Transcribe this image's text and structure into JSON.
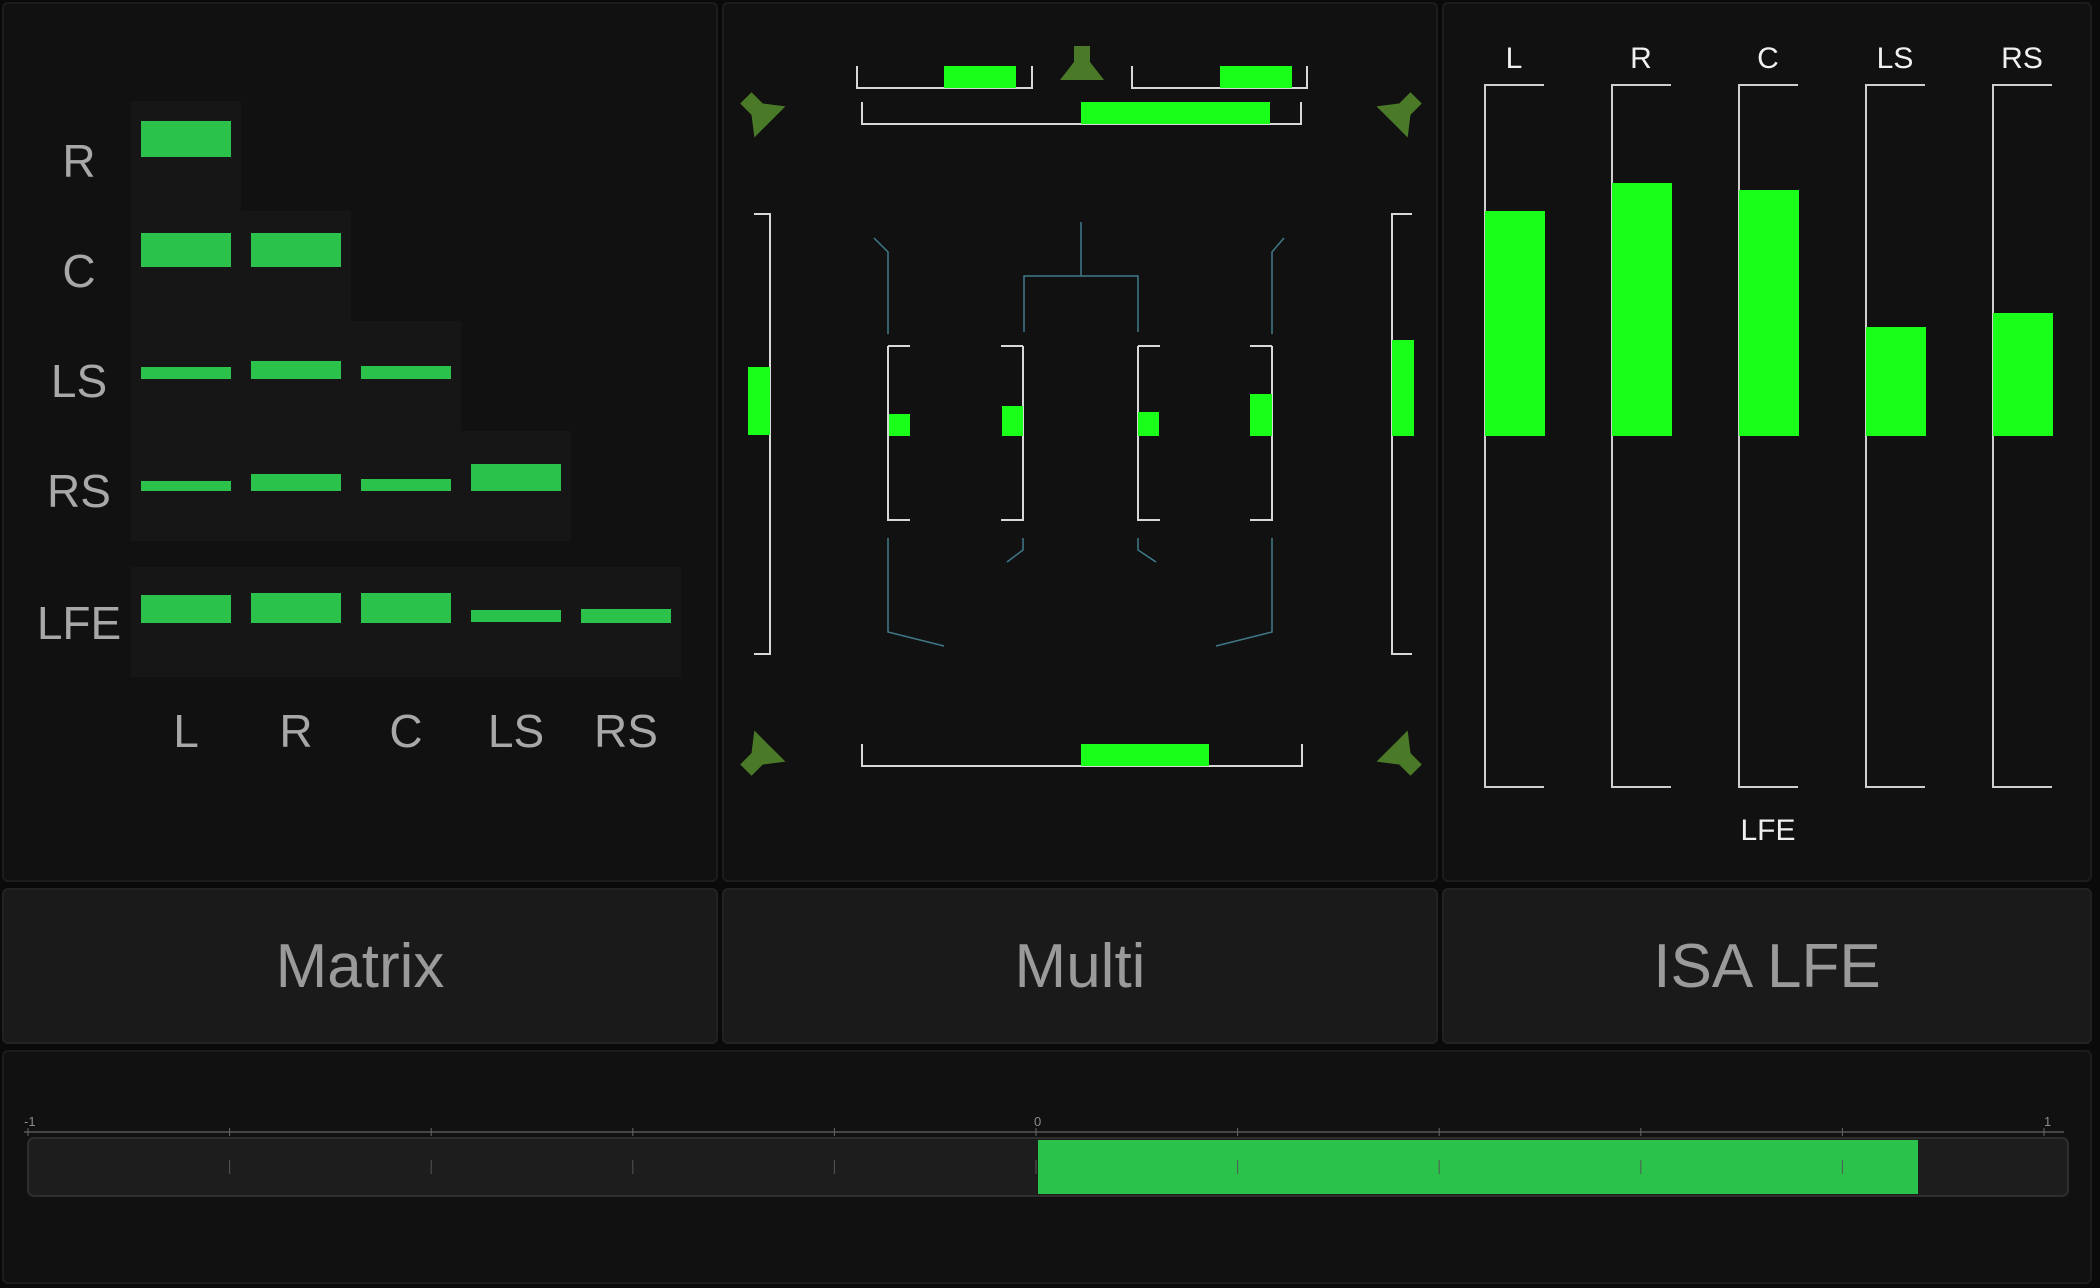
{
  "matrix": {
    "row_labels": [
      "R",
      "C",
      "LS",
      "RS",
      "LFE"
    ],
    "col_labels": [
      "L",
      "R",
      "C",
      "LS",
      "RS"
    ]
  },
  "isa": {
    "channels": [
      {
        "label": "L",
        "level": 0.32
      },
      {
        "label": "R",
        "level": 0.36
      },
      {
        "label": "C",
        "level": 0.35
      },
      {
        "label": "LS",
        "level": 0.155
      },
      {
        "label": "RS",
        "level": 0.175
      }
    ],
    "footer_label": "LFE"
  },
  "buttons": {
    "matrix": "Matrix",
    "multi": "Multi",
    "isa_lfe": "ISA LFE"
  },
  "bottom_meter": {
    "tick_min": "-1",
    "tick_zero": "0",
    "tick_max": "1",
    "value": 0.875
  },
  "colors": {
    "meter_green": "#19ff19",
    "matrix_green": "#2ac24a",
    "speaker_olive": "#4a7a28",
    "trace_blue": "#3f7a8a"
  }
}
